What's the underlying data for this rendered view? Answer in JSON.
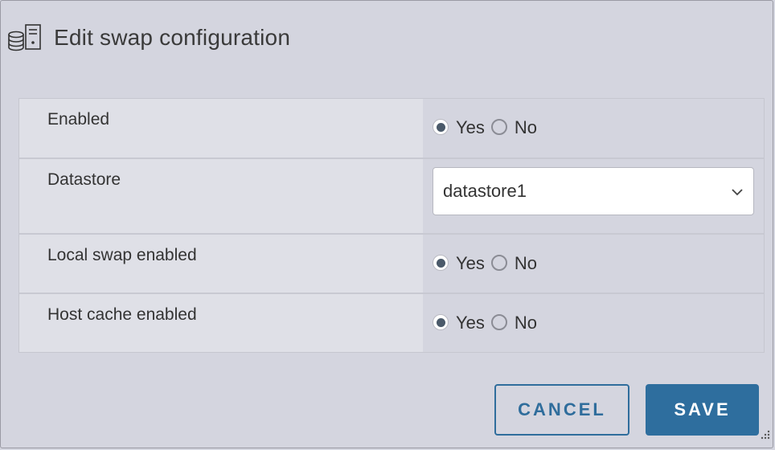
{
  "dialog": {
    "title": "Edit swap configuration",
    "header_icon": "host-storage-icon"
  },
  "form": {
    "rows": [
      {
        "label": "Enabled",
        "type": "radio",
        "options": [
          "Yes",
          "No"
        ],
        "selected": "Yes"
      },
      {
        "label": "Datastore",
        "type": "select",
        "value": "datastore1"
      },
      {
        "label": "Local swap enabled",
        "type": "radio",
        "options": [
          "Yes",
          "No"
        ],
        "selected": "Yes"
      },
      {
        "label": "Host cache enabled",
        "type": "radio",
        "options": [
          "Yes",
          "No"
        ],
        "selected": "Yes"
      }
    ]
  },
  "footer": {
    "cancel_label": "CANCEL",
    "save_label": "SAVE"
  },
  "colors": {
    "accent": "#2e6e9e",
    "background": "#d4d5df",
    "label_cell": "#dfe0e7"
  }
}
